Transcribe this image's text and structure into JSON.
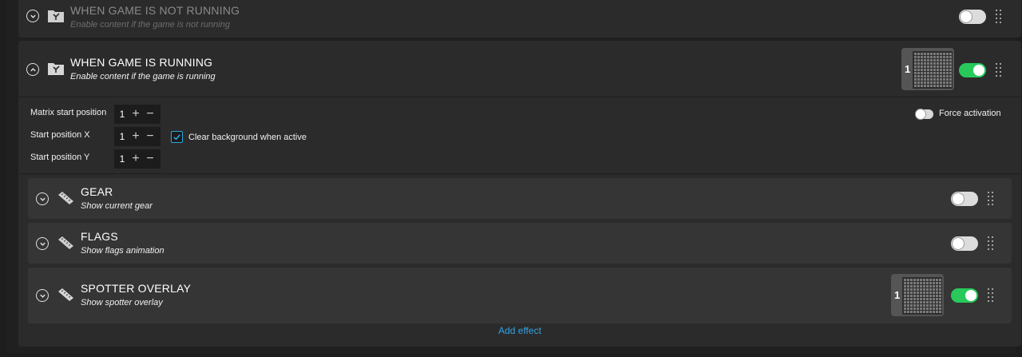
{
  "triggers": [
    {
      "title": "WHEN GAME IS NOT RUNNING",
      "subtitle": "Enable content if the game is not running",
      "enabled": false,
      "expanded": false
    },
    {
      "title": "WHEN GAME IS RUNNING",
      "subtitle": "Enable content if the game is running",
      "enabled": true,
      "expanded": true,
      "matrix_number": "1",
      "fields": {
        "matrix_start_position": {
          "label": "Matrix start position",
          "value": "1"
        },
        "start_position_x": {
          "label": "Start position X",
          "value": "1"
        },
        "start_position_y": {
          "label": "Start position Y",
          "value": "1"
        }
      },
      "clear_background": {
        "label": "Clear background when active",
        "checked": true
      },
      "force_activation": {
        "label": "Force activation",
        "checked": false
      },
      "effects": [
        {
          "title": "GEAR",
          "subtitle": "Show current gear",
          "enabled": false
        },
        {
          "title": "FLAGS",
          "subtitle": "Show flags animation",
          "enabled": false
        },
        {
          "title": "SPOTTER OVERLAY",
          "subtitle": "Show spotter overlay",
          "enabled": true,
          "matrix_number": "1"
        }
      ],
      "add_effect_label": "Add effect"
    }
  ],
  "icons": {
    "plus": "+",
    "minus": "−"
  },
  "colors": {
    "toggle_on": "#27c95a",
    "link": "#2ea3e6",
    "checkbox": "#2aa7e0"
  }
}
